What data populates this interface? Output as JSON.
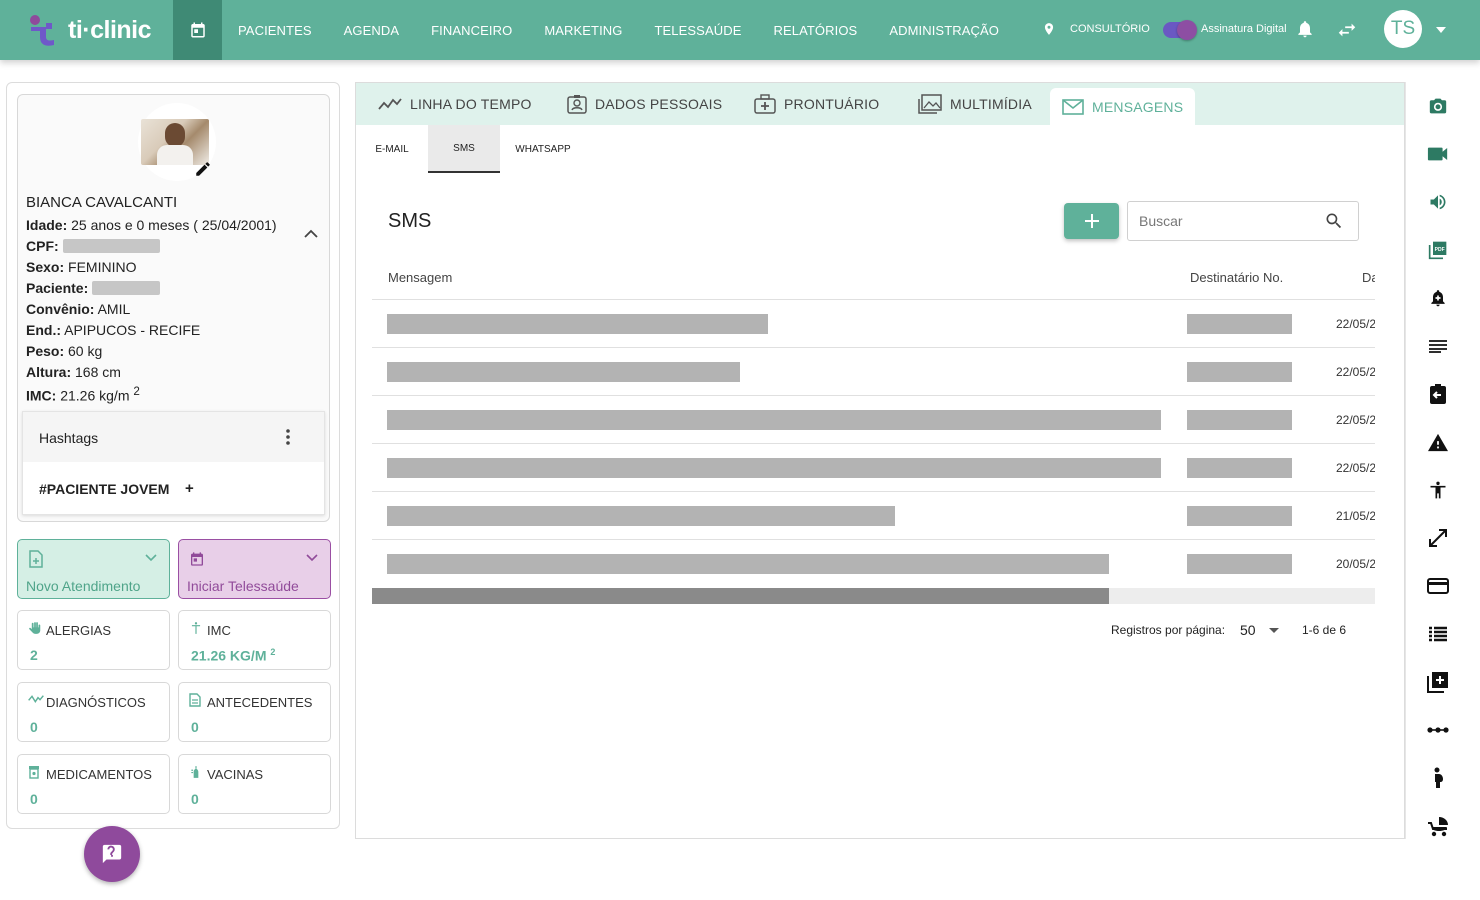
{
  "brand": {
    "name": "ti·clinic"
  },
  "nav": {
    "items": [
      "PACIENTES",
      "AGENDA",
      "FINANCEIRO",
      "MARKETING",
      "TELESSAÚDE",
      "RELATÓRIOS",
      "ADMINISTRAÇÃO"
    ]
  },
  "topbar": {
    "location_label": "CONSULTÓRIO",
    "signature_label": "Assinatura Digital",
    "user_initials": "TS"
  },
  "patient": {
    "name": "BIANCA CAVALCANTI",
    "idade_label": "Idade:",
    "idade": "25 anos e 0 meses ( 25/04/2001)",
    "cpf_label": "CPF:",
    "sexo_label": "Sexo:",
    "sexo": "FEMININO",
    "paciente_label": "Paciente:",
    "convenio_label": "Convênio:",
    "convenio": "AMIL",
    "end_label": "End.:",
    "end": "APIPUCOS -  RECIFE",
    "peso_label": "Peso:",
    "peso": "60 kg",
    "altura_label": "Altura:",
    "altura": "168 cm",
    "imc_label": "IMC:",
    "imc": "21.26 kg/m",
    "imc_sup": "2"
  },
  "hashtags": {
    "title": "Hashtags",
    "tags": [
      "#PACIENTE JOVEM"
    ],
    "add": "+"
  },
  "actions": {
    "novo": "Novo Atendimento",
    "tele": "Iniciar Telessaúde"
  },
  "summary": [
    {
      "title": "ALERGIAS",
      "value": "2",
      "icon": "hand-icon"
    },
    {
      "title": "IMC",
      "value": "21.26 KG/M",
      "sup": "2",
      "icon": "scale-icon"
    },
    {
      "title": "DIAGNÓSTICOS",
      "value": "0",
      "icon": "pulse-icon"
    },
    {
      "title": "ANTECEDENTES",
      "value": "0",
      "icon": "document-icon"
    },
    {
      "title": "MEDICAMENTOS",
      "value": "0",
      "icon": "pill-bottle-icon"
    },
    {
      "title": "VACINAS",
      "value": "0",
      "icon": "vaccine-icon"
    }
  ],
  "tabs": [
    {
      "label": "LINHA DO TEMPO",
      "icon": "timeline-icon"
    },
    {
      "label": "DADOS PESSOAIS",
      "icon": "id-card-icon"
    },
    {
      "label": "PRONTUÁRIO",
      "icon": "medical-kit-icon"
    },
    {
      "label": "MULTIMÍDIA",
      "icon": "images-icon"
    },
    {
      "label": "MENSAGENS",
      "icon": "envelope-icon",
      "active": true
    }
  ],
  "subtabs": [
    {
      "label": "E-MAIL"
    },
    {
      "label": "SMS",
      "active": true
    },
    {
      "label": "WHATSAPP"
    }
  ],
  "sms": {
    "title": "SMS",
    "search_placeholder": "Buscar",
    "columns": [
      "Mensagem",
      "Destinatário No.",
      "Da"
    ],
    "rows": [
      {
        "date": "22/05/2"
      },
      {
        "date": "22/05/2"
      },
      {
        "date": "22/05/2"
      },
      {
        "date": "22/05/2"
      },
      {
        "date": "21/05/2"
      },
      {
        "date": "20/05/2"
      }
    ],
    "pager": {
      "label": "Registros por página:",
      "per_page": "50",
      "range": "1-6 de 6"
    }
  },
  "rail": [
    "camera-icon",
    "video-icon",
    "speaker-icon",
    "pdf-icon",
    "alarm-add-icon",
    "list-lines-icon",
    "clipboard-arrow-icon",
    "warning-icon",
    "accessibility-icon",
    "expand-icon",
    "card-icon",
    "list-icon",
    "add-box-icon",
    "dots-line-icon",
    "pregnant-icon",
    "stroller-icon"
  ],
  "colors": {
    "primary": "#5fb19a",
    "primary_dark": "#3f8a75",
    "purple": "#8f4a9c",
    "tab_bg": "#dff2ec"
  }
}
